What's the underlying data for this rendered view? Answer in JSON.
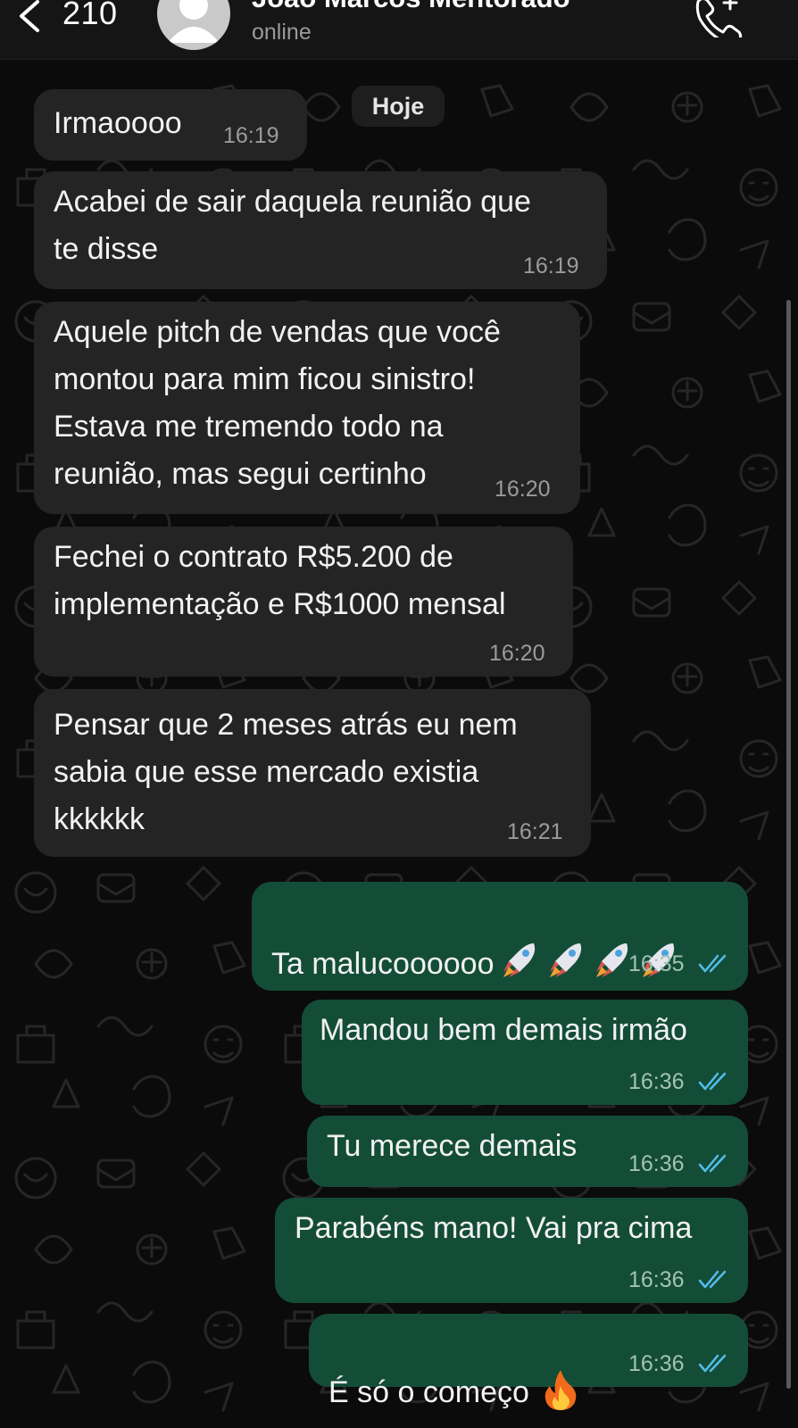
{
  "header": {
    "back_count": "210",
    "contact_name": "João Marcos Mentorado",
    "status": "online"
  },
  "chat": {
    "date_label": "Hoje",
    "messages": [
      {
        "direction": "incoming",
        "text": "Irmaoooo",
        "time": "16:19"
      },
      {
        "direction": "incoming",
        "text": "Acabei de sair daquela reunião que\nte disse",
        "time": "16:19"
      },
      {
        "direction": "incoming",
        "text": "Aquele pitch de vendas que você\nmontou para mim ficou sinistro!\nEstava me tremendo todo na\nreunião, mas segui certinho",
        "time": "16:20"
      },
      {
        "direction": "incoming",
        "text": "Fechei o contrato R$5.200 de\nimplementação e R$1000 mensal",
        "time": "16:20"
      },
      {
        "direction": "incoming",
        "text": "Pensar que 2 meses atrás eu nem\nsabia que esse mercado existia\nkkkkkk",
        "time": "16:21"
      },
      {
        "direction": "outgoing",
        "text": "Ta malucoooooo",
        "emoji": "rocket x4",
        "time": "16:35",
        "status": "read"
      },
      {
        "direction": "outgoing",
        "text": "Mandou bem demais irmão",
        "time": "16:36",
        "status": "read"
      },
      {
        "direction": "outgoing",
        "text": "Tu merece demais",
        "time": "16:36",
        "status": "read"
      },
      {
        "direction": "outgoing",
        "text": "Parabéns mano! Vai pra cima",
        "time": "16:36",
        "status": "read"
      },
      {
        "direction": "outgoing",
        "text": "É só o começo",
        "emoji": "fire",
        "time": "16:36",
        "status": "read"
      }
    ]
  },
  "colors": {
    "incoming_bubble": "#242424",
    "outgoing_bubble": "#144d37",
    "read_ticks": "#53bdeb",
    "background": "#0b0b0b"
  },
  "icons": {
    "back": "chevron-left-icon",
    "avatar": "default-avatar-icon",
    "call": "phone-plus-icon",
    "read": "double-check-icon",
    "rocket": "rocket-emoji",
    "fire": "fire-emoji"
  }
}
